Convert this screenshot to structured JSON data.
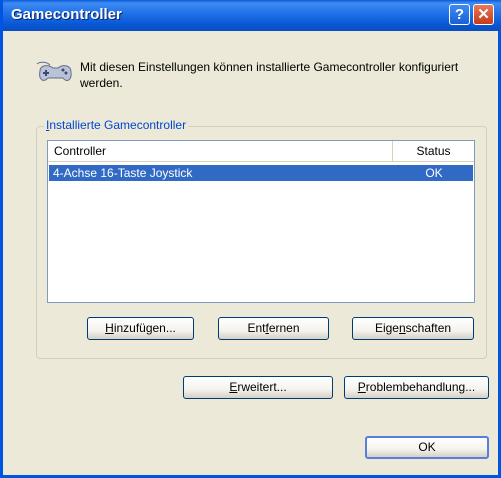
{
  "window": {
    "title": "Gamecontroller"
  },
  "titlebar": {
    "help_glyph": "?",
    "close_glyph": "✕"
  },
  "intro": {
    "text": "Mit diesen Einstellungen können installierte Gamecontroller konfiguriert werden.",
    "icon": "gamepad-icon"
  },
  "group": {
    "label_accel": "I",
    "label_rest": "nstallierte Gamecontroller"
  },
  "list": {
    "columns": [
      "Controller",
      "Status"
    ],
    "rows": [
      {
        "controller": "4-Achse 16-Taste Joystick",
        "status": "OK",
        "selected": true
      }
    ]
  },
  "buttons": {
    "add": {
      "pre": "",
      "accel": "H",
      "post": "inzufügen..."
    },
    "remove": {
      "pre": "Ent",
      "accel": "f",
      "post": "ernen"
    },
    "properties": {
      "pre": "Eige",
      "accel": "n",
      "post": "schaften"
    },
    "advanced": {
      "pre": "",
      "accel": "E",
      "post": "rweitert..."
    },
    "troubleshoot": {
      "pre": "",
      "accel": "P",
      "post": "roblembehandlung..."
    },
    "ok": {
      "label": "OK"
    }
  },
  "colors": {
    "title_bar": "#0A5BD8",
    "selection": "#316AC5",
    "dialog_bg": "#ECE9D8",
    "group_label": "#0046D5"
  }
}
